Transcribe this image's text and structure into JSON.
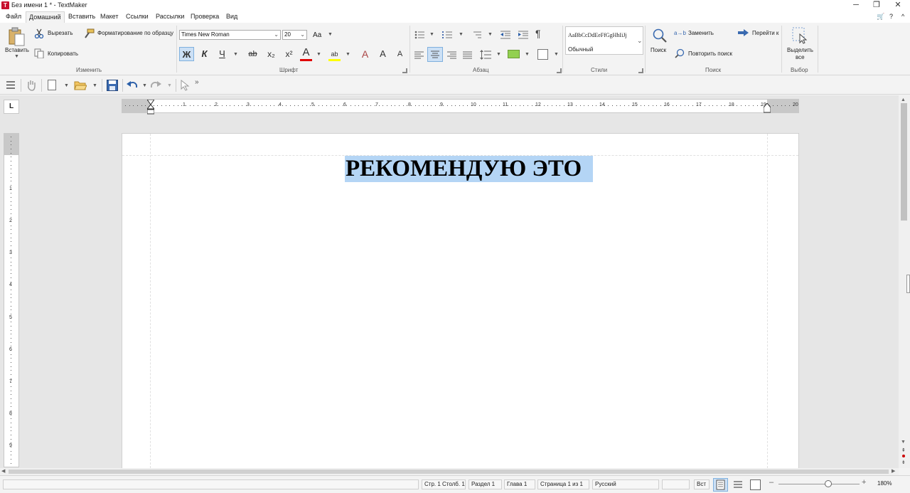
{
  "window": {
    "title": "Без имени 1 * - TextMaker",
    "logo": "T",
    "minimize_icon": "─",
    "restore_icon": "❐",
    "close_icon": "✕"
  },
  "menu": {
    "items": [
      "Файл",
      "Домашний",
      "Вставить",
      "Макет",
      "Ссылки",
      "Рассылки",
      "Проверка",
      "Вид"
    ],
    "right_icons": [
      "cart-icon",
      "help-icon"
    ],
    "cart_glyph": "🛒",
    "help_glyph": "?",
    "collapse_glyph": "^"
  },
  "ribbon": {
    "clipboard": {
      "paste": "Вставить",
      "cut": "Вырезать",
      "copy": "Копировать",
      "format_painter": "Форматирование по образцу",
      "group": "Изменить"
    },
    "font": {
      "name": "Times New Roman",
      "size": "20",
      "case_glyph": "Aa",
      "bold": "Ж",
      "italic": "К",
      "underline": "Ч",
      "strike": "ab",
      "sub": "x₂",
      "sup": "x²",
      "color_glyph": "A",
      "highlight_glyph": "ab",
      "clear_glyph": "A",
      "grow_glyph": "A",
      "shrink_glyph": "A",
      "group": "Шрифт",
      "font_color": "#e00000",
      "highlight_color": "#ffff00"
    },
    "paragraph": {
      "group": "Абзац",
      "pilcrow": "¶",
      "shading_color": "#92d050"
    },
    "styles": {
      "preview": "AaBbCcDdEeFfGgHhIiJj",
      "current": "Обычный",
      "group": "Стили"
    },
    "search": {
      "search": "Поиск",
      "replace": "Заменить",
      "repeat": "Повторить поиск",
      "goto": "Перейти к",
      "group": "Поиск",
      "replace_glyph": "a→b"
    },
    "selection": {
      "select_all_1": "Выделить",
      "select_all_2": "все",
      "group": "Выбор"
    }
  },
  "toolbar": {
    "more_glyph": "»"
  },
  "ruler": {
    "corner": "L",
    "h_numbers": [
      "1",
      "2",
      "3",
      "4",
      "5",
      "6",
      "7",
      "8",
      "9",
      "10",
      "11",
      "12",
      "13",
      "14",
      "15",
      "16",
      "17",
      "18",
      "19",
      "20"
    ],
    "v_numbers": [
      "1",
      "2",
      "3",
      "4",
      "5",
      "6",
      "7",
      "8",
      "9"
    ]
  },
  "document": {
    "heading": "РЕКОМЕНДУЮ ЭТО"
  },
  "status": {
    "position": "Стр. 1 Столб. 1",
    "section": "Раздел 1",
    "chapter": "Глава 1",
    "page": "Страница 1 из 1",
    "language": "Русский",
    "mode": "Вст",
    "zoom": "180%",
    "zoom_out": "–",
    "zoom_in": "+"
  }
}
